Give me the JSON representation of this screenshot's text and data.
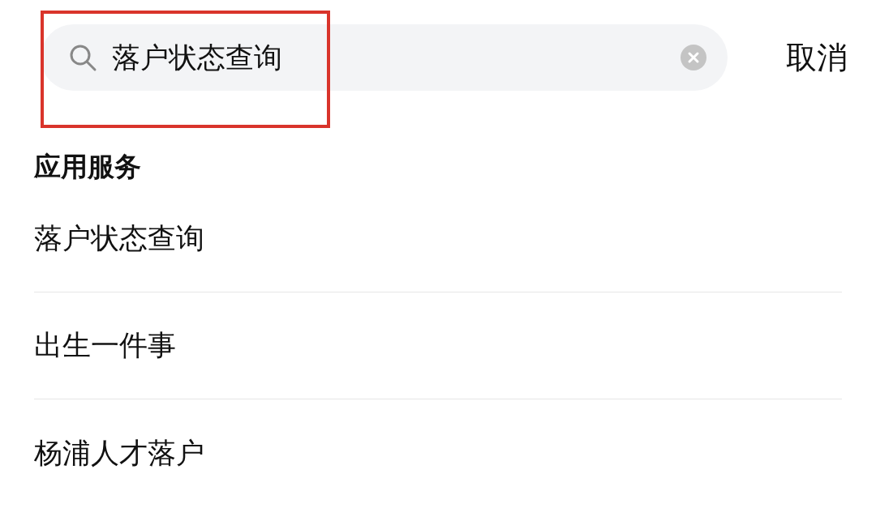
{
  "search": {
    "value": "落户状态查询",
    "cancel": "取消"
  },
  "section": {
    "title": "应用服务",
    "items": [
      {
        "label": "落户状态查询"
      },
      {
        "label": "出生一件事"
      },
      {
        "label": "杨浦人才落户"
      }
    ]
  }
}
